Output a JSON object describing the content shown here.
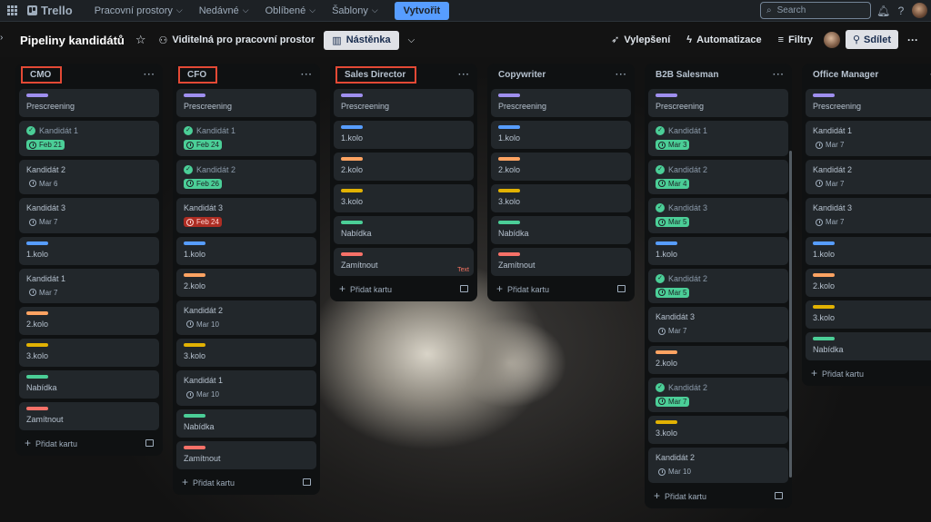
{
  "topbar": {
    "logo": "Trello",
    "nav": [
      "Pracovní prostory",
      "Nedávné",
      "Oblíbené",
      "Šablony"
    ],
    "create_label": "Vytvořit",
    "search_placeholder": "Search"
  },
  "board": {
    "title": "Pipeliny kandidátů",
    "visibility": "Viditelná pro pracovní prostor",
    "view": "Nástěnka",
    "actions": {
      "upgrade": "Vylepšení",
      "automation": "Automatizace",
      "filters": "Filtry",
      "share": "Sdílet"
    }
  },
  "add_card_label": "Přidat kartu",
  "colors": {
    "purple": "#9f8fef",
    "blue": "#579dff",
    "orange": "#fea362",
    "yellow": "#e2b203",
    "green": "#4bce97",
    "red": "#f87168",
    "highlight": "#e34935"
  },
  "lists": [
    {
      "title": "CMO",
      "highlighted": true,
      "cards": [
        {
          "label": "purple",
          "title": "Prescreening"
        },
        {
          "title": "Kandidát 1",
          "done": true,
          "date": "Feb 21",
          "date_style": "green"
        },
        {
          "title": "Kandidát 2",
          "date": "Mar 6"
        },
        {
          "title": "Kandidát 3",
          "date": "Mar 7"
        },
        {
          "label": "blue",
          "title": "1.kolo"
        },
        {
          "title": "Kandidát 1",
          "date": "Mar 7"
        },
        {
          "label": "orange",
          "title": "2.kolo"
        },
        {
          "label": "yellow",
          "title": "3.kolo"
        },
        {
          "label": "green",
          "title": "Nabídka"
        },
        {
          "label": "red",
          "title": "Zamítnout"
        }
      ]
    },
    {
      "title": "CFO",
      "highlighted": true,
      "cards": [
        {
          "label": "purple",
          "title": "Prescreening"
        },
        {
          "title": "Kandidát 1",
          "done": true,
          "date": "Feb 24",
          "date_style": "green"
        },
        {
          "title": "Kandidát 2",
          "done": true,
          "date": "Feb 26",
          "date_style": "green"
        },
        {
          "title": "Kandidát 3",
          "date": "Feb 24",
          "date_style": "red"
        },
        {
          "label": "blue",
          "title": "1.kolo"
        },
        {
          "label": "orange",
          "title": "2.kolo"
        },
        {
          "title": "Kandidát 2",
          "date": "Mar 10"
        },
        {
          "label": "yellow",
          "title": "3.kolo"
        },
        {
          "title": "Kandidát 1",
          "date": "Mar 10"
        },
        {
          "label": "green",
          "title": "Nabídka"
        },
        {
          "label": "red",
          "title": "Zamítnout"
        }
      ]
    },
    {
      "title": "Sales Director",
      "highlighted": true,
      "cards": [
        {
          "label": "purple",
          "title": "Prescreening"
        },
        {
          "label": "blue",
          "title": "1.kolo"
        },
        {
          "label": "orange",
          "title": "2.kolo"
        },
        {
          "label": "yellow",
          "title": "3.kolo"
        },
        {
          "label": "green",
          "title": "Nabídka"
        },
        {
          "label": "red",
          "title": "Zamítnout",
          "extra": "Text"
        }
      ]
    },
    {
      "title": "Copywriter",
      "highlighted": false,
      "cards": [
        {
          "label": "purple",
          "title": "Prescreening"
        },
        {
          "label": "blue",
          "title": "1.kolo"
        },
        {
          "label": "orange",
          "title": "2.kolo"
        },
        {
          "label": "yellow",
          "title": "3.kolo"
        },
        {
          "label": "green",
          "title": "Nabídka"
        },
        {
          "label": "red",
          "title": "Zamítnout"
        }
      ]
    },
    {
      "title": "B2B Salesman",
      "highlighted": false,
      "cards": [
        {
          "label": "purple",
          "title": "Prescreening"
        },
        {
          "title": "Kandidát 1",
          "done": true,
          "date": "Mar 3",
          "date_style": "green"
        },
        {
          "title": "Kandidát 2",
          "done": true,
          "date": "Mar 4",
          "date_style": "green"
        },
        {
          "title": "Kandidát 3",
          "done": true,
          "date": "Mar 5",
          "date_style": "green"
        },
        {
          "label": "blue",
          "title": "1.kolo"
        },
        {
          "title": "Kandidát 2",
          "done": true,
          "date": "Mar 5",
          "date_style": "green"
        },
        {
          "title": "Kandidát 3",
          "date": "Mar 7"
        },
        {
          "label": "orange",
          "title": "2.kolo"
        },
        {
          "title": "Kandidát 2",
          "done": true,
          "date": "Mar 7",
          "date_style": "green"
        },
        {
          "label": "yellow",
          "title": "3.kolo"
        },
        {
          "title": "Kandidát 2",
          "date": "Mar 10"
        }
      ]
    },
    {
      "title": "Office Manager",
      "highlighted": false,
      "cards": [
        {
          "label": "purple",
          "title": "Prescreening"
        },
        {
          "title": "Kandidát 1",
          "date": "Mar 7"
        },
        {
          "title": "Kandidát 2",
          "date": "Mar 7"
        },
        {
          "title": "Kandidát 3",
          "date": "Mar 7"
        },
        {
          "label": "blue",
          "title": "1.kolo"
        },
        {
          "label": "orange",
          "title": "2.kolo"
        },
        {
          "label": "yellow",
          "title": "3.kolo"
        },
        {
          "label": "green",
          "title": "Nabídka"
        }
      ]
    }
  ]
}
